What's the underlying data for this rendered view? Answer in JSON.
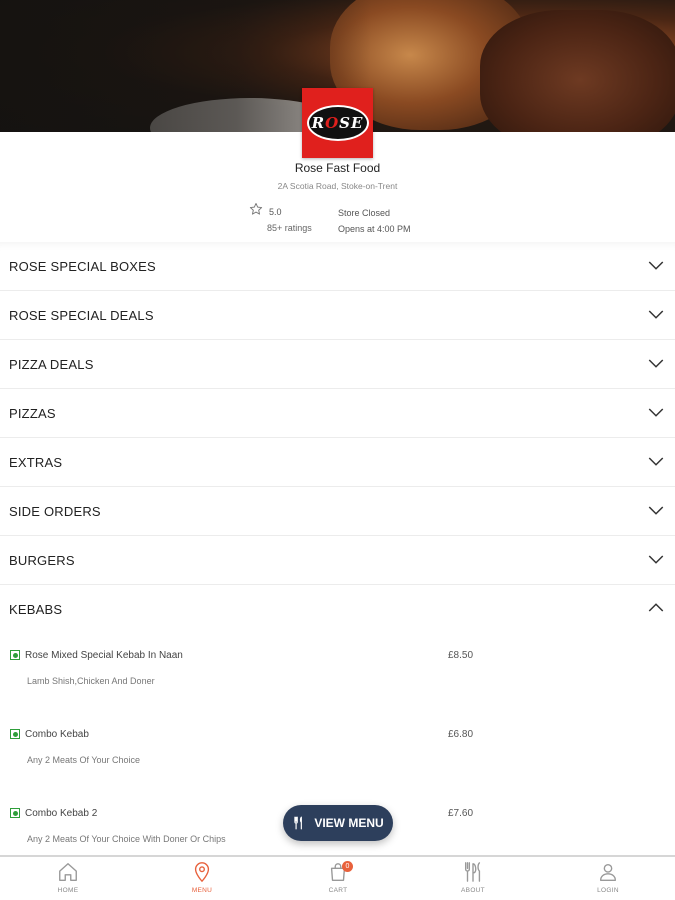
{
  "store": {
    "name": "Rose Fast Food",
    "address": "2A Scotia Road, Stoke-on-Trent",
    "rating": "5.0",
    "rating_count": "85+ ratings",
    "status": "Store Closed",
    "opens": "Opens at 4:00 PM",
    "logo_text_pre": "R",
    "logo_text_o": "O",
    "logo_text_post": "SE"
  },
  "categories": [
    {
      "label": "ROSE SPECIAL BOXES",
      "expanded": false
    },
    {
      "label": "ROSE SPECIAL DEALS",
      "expanded": false
    },
    {
      "label": "PIZZA DEALS",
      "expanded": false
    },
    {
      "label": "PIZZAS",
      "expanded": false
    },
    {
      "label": "EXTRAS",
      "expanded": false
    },
    {
      "label": "SIDE ORDERS",
      "expanded": false
    },
    {
      "label": "BURGERS",
      "expanded": false
    },
    {
      "label": "KEBABS",
      "expanded": true
    }
  ],
  "items": [
    {
      "name": "Rose Mixed Special Kebab In Naan",
      "price": "£8.50",
      "desc": "Lamb Shish,Chicken And Doner"
    },
    {
      "name": "Combo Kebab",
      "price": "£6.80",
      "desc": "Any 2 Meats Of Your Choice"
    },
    {
      "name": "Combo Kebab 2",
      "price": "£7.60",
      "desc": "Any 2 Meats Of Your Choice With Doner Or Chips"
    }
  ],
  "view_menu_label": "VIEW MENU",
  "tabs": [
    {
      "label": "HOME",
      "icon": "home-icon"
    },
    {
      "label": "MENU",
      "icon": "location-pin-icon",
      "active": true
    },
    {
      "label": "CART",
      "icon": "cart-icon",
      "badge": "0"
    },
    {
      "label": "ABOUT",
      "icon": "cutlery-icon"
    },
    {
      "label": "LOGIN",
      "icon": "user-icon"
    }
  ],
  "colors": {
    "accent": "#e8613c",
    "button_bg": "#2d3f5c",
    "logo_red": "#e0201d",
    "veg_green": "#2e9e3a"
  }
}
